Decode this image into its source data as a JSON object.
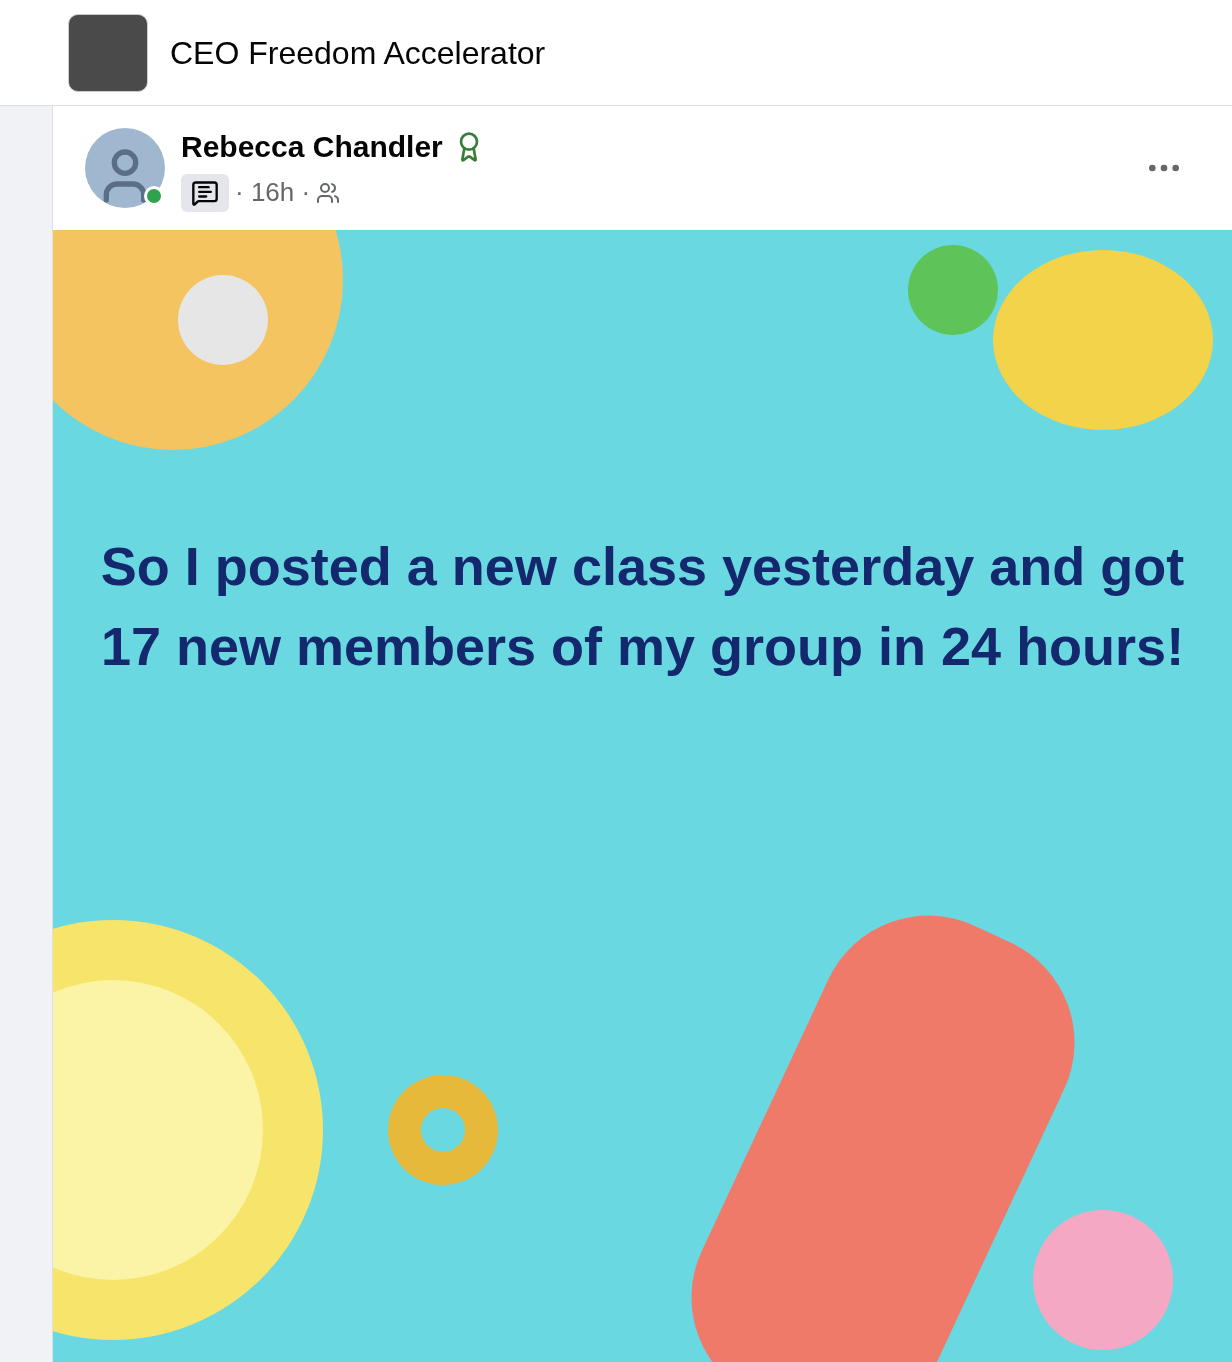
{
  "group": {
    "name": "CEO Freedom Accelerator"
  },
  "post": {
    "author": "Rebecca Chandler",
    "online": true,
    "meta": "· 16h ·",
    "text": "So I posted a new class yesterday and got 17 new members of my group in 24 hours!"
  }
}
